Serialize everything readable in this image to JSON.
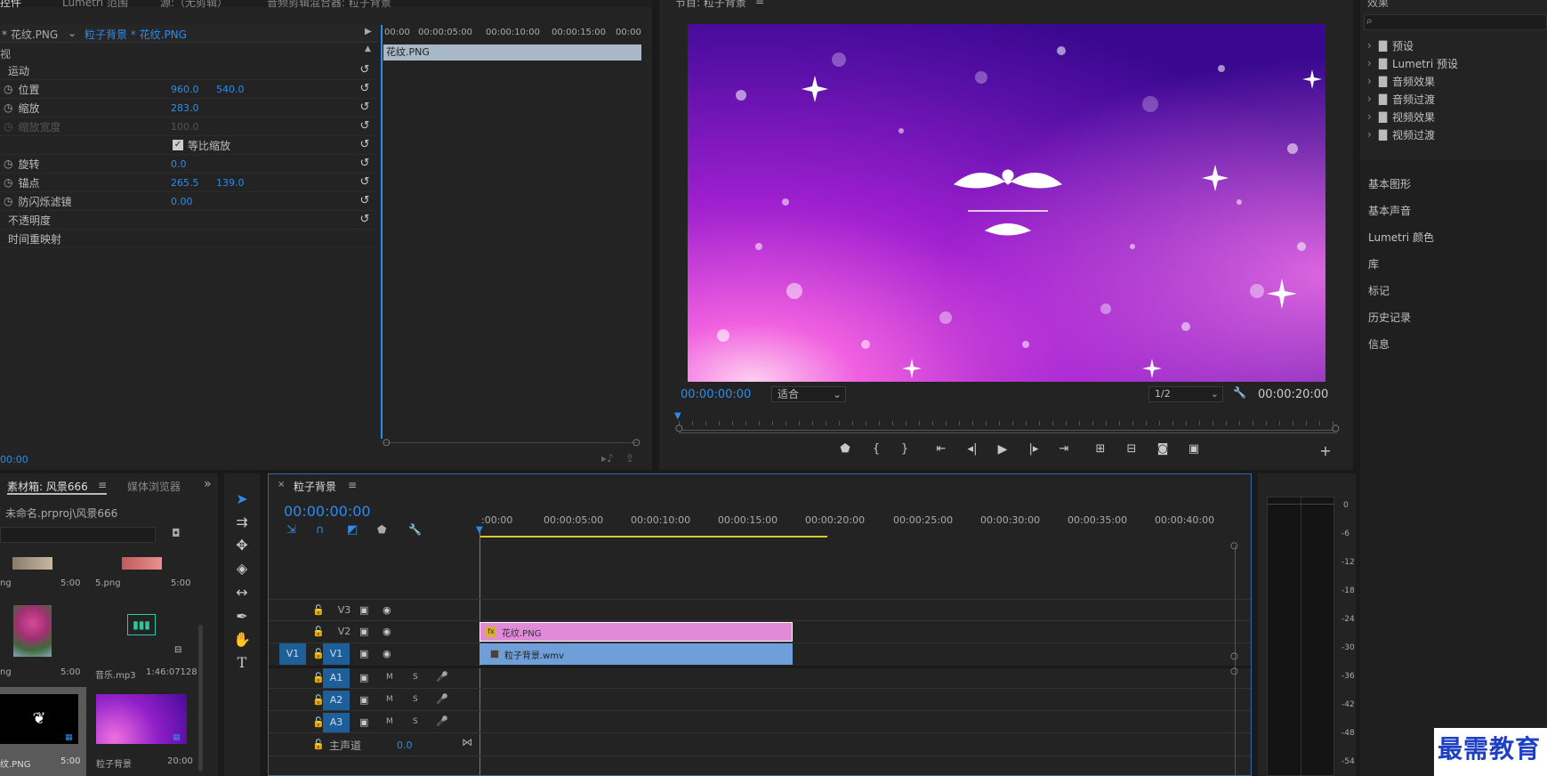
{
  "effect_controls": {
    "tab_label": "控件",
    "tab2": "Lumetri 范围",
    "tab3": "源:（无剪辑）",
    "tab4": "音频剪辑混合器: 粒子背景",
    "source_clip": "* 花纹.PNG",
    "seq_clip": "粒子背景 * 花纹.PNG",
    "section": "视",
    "motion": "运动",
    "position_label": "位置",
    "position_x": "960.0",
    "position_y": "540.0",
    "scale_label": "缩放",
    "scale_value": "283.0",
    "scale_width_label": "缩放宽度",
    "scale_width_value": "100.0",
    "uniform_label": "等比缩放",
    "rotation_label": "旋转",
    "rotation_value": "0.0",
    "anchor_label": "锚点",
    "anchor_x": "265.5",
    "anchor_y": "139.0",
    "flicker_label": "防闪烁滤镜",
    "flicker_value": "0.00",
    "opacity_label": "不透明度",
    "remap_label": "时间重映射",
    "timecode": "00:00",
    "ruler": [
      "00:00",
      "00:00:05:00",
      "00:00:10:00",
      "00:00:15:00",
      "00:00"
    ],
    "mini_clip": "花纹.PNG"
  },
  "program": {
    "title": "节目: 粒子背景",
    "timecode": "00:00:00:00",
    "fit": "适合",
    "resolution": "1/2",
    "duration": "00:00:20:00"
  },
  "effects": {
    "title": "效果",
    "items": [
      "预设",
      "Lumetri 预设",
      "音频效果",
      "音频过渡",
      "视频效果",
      "视频过渡"
    ],
    "panels": [
      "基本图形",
      "基本声音",
      "Lumetri 颜色",
      "库",
      "标记",
      "历史记录",
      "信息"
    ]
  },
  "project": {
    "tab_label": "素材箱: 风景666",
    "tab2": "媒体浏览器",
    "path": "未命名.prproj\\风景666",
    "items": [
      {
        "name": "ng",
        "dur": "5:00"
      },
      {
        "name": "5.png",
        "dur": "5:00"
      },
      {
        "name": "ng",
        "dur": "5:00"
      },
      {
        "name": "音乐.mp3",
        "dur": "1:46:07128"
      },
      {
        "name": "纹.PNG",
        "dur": "5:00"
      },
      {
        "name": "粒子背景",
        "dur": "20:00"
      }
    ]
  },
  "timeline": {
    "title": "粒子背景",
    "timecode": "00:00:00:00",
    "ruler": [
      ":00:00",
      "00:00:05:00",
      "00:00:10:00",
      "00:00:15:00",
      "00:00:20:00",
      "00:00:25:00",
      "00:00:30:00",
      "00:00:35:00",
      "00:00:40:00"
    ],
    "tracks": [
      "V3",
      "V2",
      "V1",
      "A1",
      "A2",
      "A3"
    ],
    "source_v1": "V1",
    "master": "主声道",
    "master_value": "0.0",
    "clip_v2": "花纹.PNG",
    "clip_v1": "粒子背景.wmv",
    "m": "M",
    "s": "S"
  },
  "meter": [
    "0",
    "-6",
    "-12",
    "-18",
    "-24",
    "-30",
    "-36",
    "-42",
    "-48",
    "-54"
  ],
  "watermark": "最需教育",
  "colors": {
    "accent": "#2d8ceb",
    "clip_pink": "#e18ad9",
    "clip_blue": "#6f9fd8"
  }
}
